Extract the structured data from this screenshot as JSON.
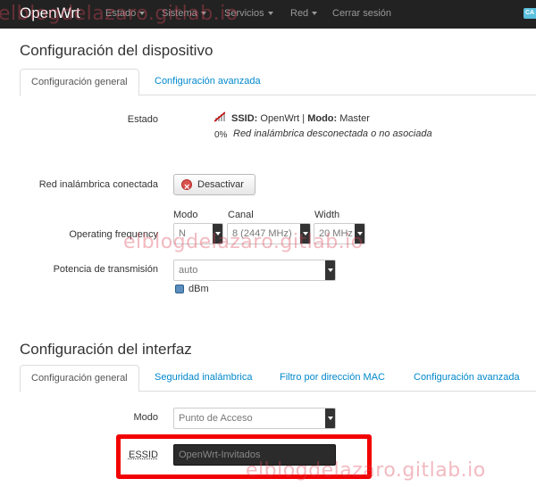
{
  "navbar": {
    "brand": "OpenWrt",
    "items": [
      {
        "label": "Estado",
        "dropdown": true
      },
      {
        "label": "Sistema",
        "dropdown": true
      },
      {
        "label": "Servicios",
        "dropdown": true
      },
      {
        "label": "Red",
        "dropdown": true
      },
      {
        "label": "Cerrar sesión",
        "dropdown": false
      }
    ],
    "badge": "CA"
  },
  "device_config": {
    "title": "Configuración del dispositivo",
    "tabs": [
      {
        "label": "Configuración general",
        "active": true
      },
      {
        "label": "Configuración avanzada",
        "active": false
      }
    ],
    "status_label": "Estado",
    "status_line1_prefix1": "SSID:",
    "status_line1_ssid": "OpenWrt",
    "status_line1_sep": "|",
    "status_line1_prefix2": "Modo:",
    "status_line1_mode": "Master",
    "status_signal": "0%",
    "status_line2": "Red inalámbrica desconectada o no asociada",
    "wireless_label": "Red inalámbrica conectada",
    "disable_button": "Desactivar",
    "freq_label": "Operating frequency",
    "mode_label": "Modo",
    "mode_value": "N",
    "channel_label": "Canal",
    "channel_value": "8 (2447 MHz)",
    "width_label": "Width",
    "width_value": "20 MHz",
    "power_label": "Potencia de transmisión",
    "power_value": "auto",
    "power_unit": "dBm"
  },
  "interface_config": {
    "title": "Configuración del interfaz",
    "tabs": [
      {
        "label": "Configuración general",
        "active": true
      },
      {
        "label": "Seguridad inalámbrica",
        "active": false
      },
      {
        "label": "Filtro por dirección MAC",
        "active": false
      },
      {
        "label": "Configuración avanzada",
        "active": false
      }
    ],
    "mode_label": "Modo",
    "mode_value": "Punto de Acceso",
    "essid_label": "ESSID",
    "essid_value": "OpenWrt-Invitados"
  },
  "watermarks": [
    "elblogdelazaro.gitlab.io",
    "elblogdelazaro.gitlab.io",
    "elblogdelazaro.gitlab.io"
  ],
  "colors": {
    "navbar": "#222222",
    "link": "#0088cc",
    "highlight": "#f20000",
    "watermark": "#dc465a"
  }
}
